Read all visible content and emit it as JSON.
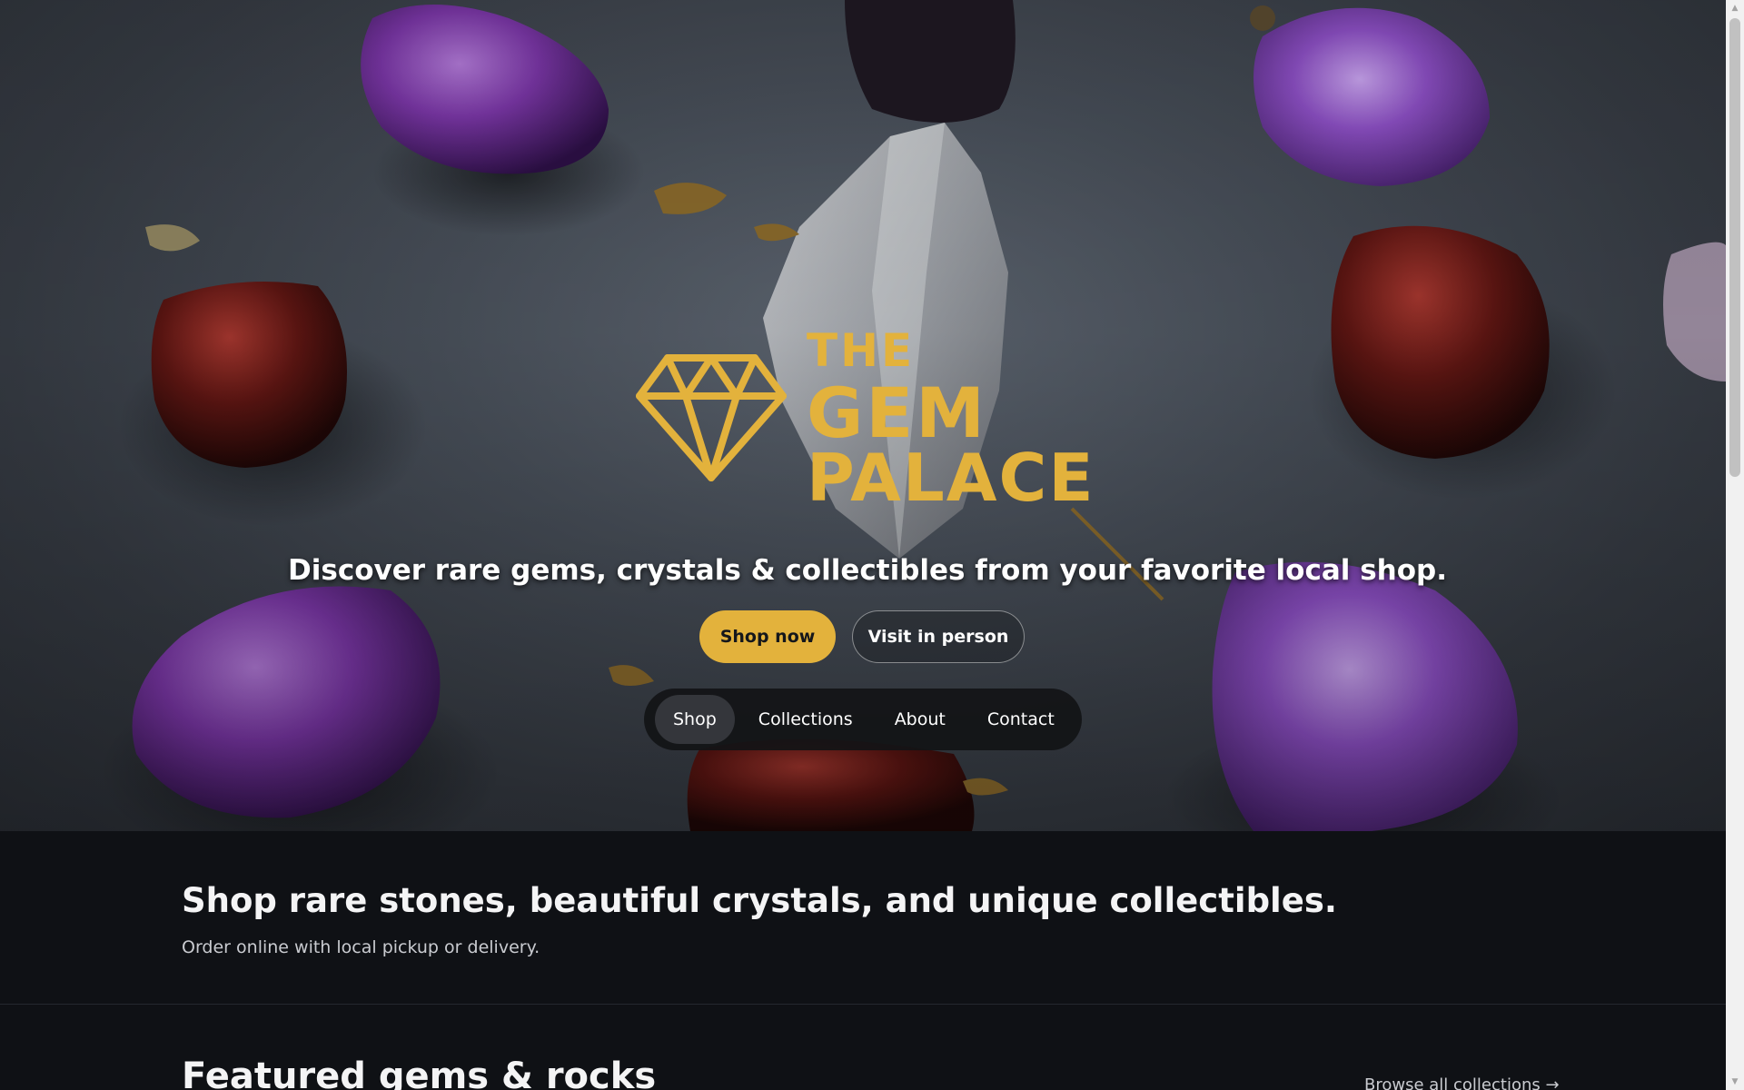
{
  "hero": {
    "background_image": "gemstones-on-slate-photo",
    "logo": {
      "icon": "diamond-icon",
      "line1": "THE",
      "line2": "GEM",
      "line3": "PALACE",
      "color": "#e3b23c"
    },
    "tagline": "Discover rare gems, crystals & collectibles from your favorite local shop.",
    "primary_cta": "Shop now",
    "secondary_cta": "Visit in person"
  },
  "nav": {
    "items": [
      {
        "label": "Shop",
        "active": true
      },
      {
        "label": "Collections",
        "active": false
      },
      {
        "label": "About",
        "active": false
      },
      {
        "label": "Contact",
        "active": false
      }
    ]
  },
  "intro": {
    "title": "Shop rare stones, beautiful crystals, and unique collectibles.",
    "subtitle": "Order online with local pickup or delivery."
  },
  "featured": {
    "title": "Featured gems & rocks",
    "browse_link": "Browse all collections →"
  },
  "colors": {
    "accent": "#e3b23c",
    "page_bg": "#0f1115",
    "nav_bg": "#121316",
    "nav_active_bg": "#34363b"
  }
}
